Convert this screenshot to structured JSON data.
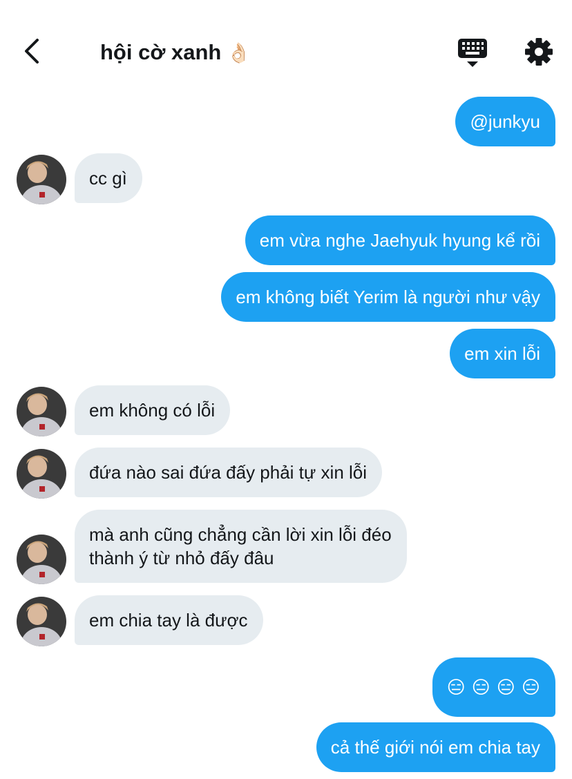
{
  "header": {
    "title": "hội cờ xanh",
    "title_emoji": "👌🏻",
    "back_icon": "chevron-left-icon",
    "keyboard_icon": "keyboard-icon",
    "settings_icon": "gear-icon"
  },
  "colors": {
    "outgoing_bubble": "#1da1f2",
    "incoming_bubble": "#e6ecf0",
    "text_dark": "#14171a"
  },
  "messages": [
    {
      "side": "out",
      "text": "@junkyu"
    },
    {
      "side": "in",
      "text": "cc gì"
    },
    {
      "side": "out",
      "text": "em vừa nghe Jaehyuk hyung kể rồi"
    },
    {
      "side": "out",
      "text": "em không biết Yerim là người như vậy"
    },
    {
      "side": "out",
      "text": "em xin lỗi"
    },
    {
      "side": "in",
      "text": "em không có lỗi"
    },
    {
      "side": "in",
      "text": "đứa nào sai đứa đấy phải tự xin lỗi"
    },
    {
      "side": "in",
      "line1": "mà anh cũng chẳng cần lời xin lỗi đéo",
      "line2": "thành ý từ nhỏ đấy đâu"
    },
    {
      "side": "in",
      "text": "em chia tay là được"
    },
    {
      "side": "out",
      "emojis": [
        "😑",
        "😑",
        "😑",
        "😑"
      ]
    },
    {
      "side": "out",
      "text": "cả thế giới nói em chia tay"
    }
  ]
}
